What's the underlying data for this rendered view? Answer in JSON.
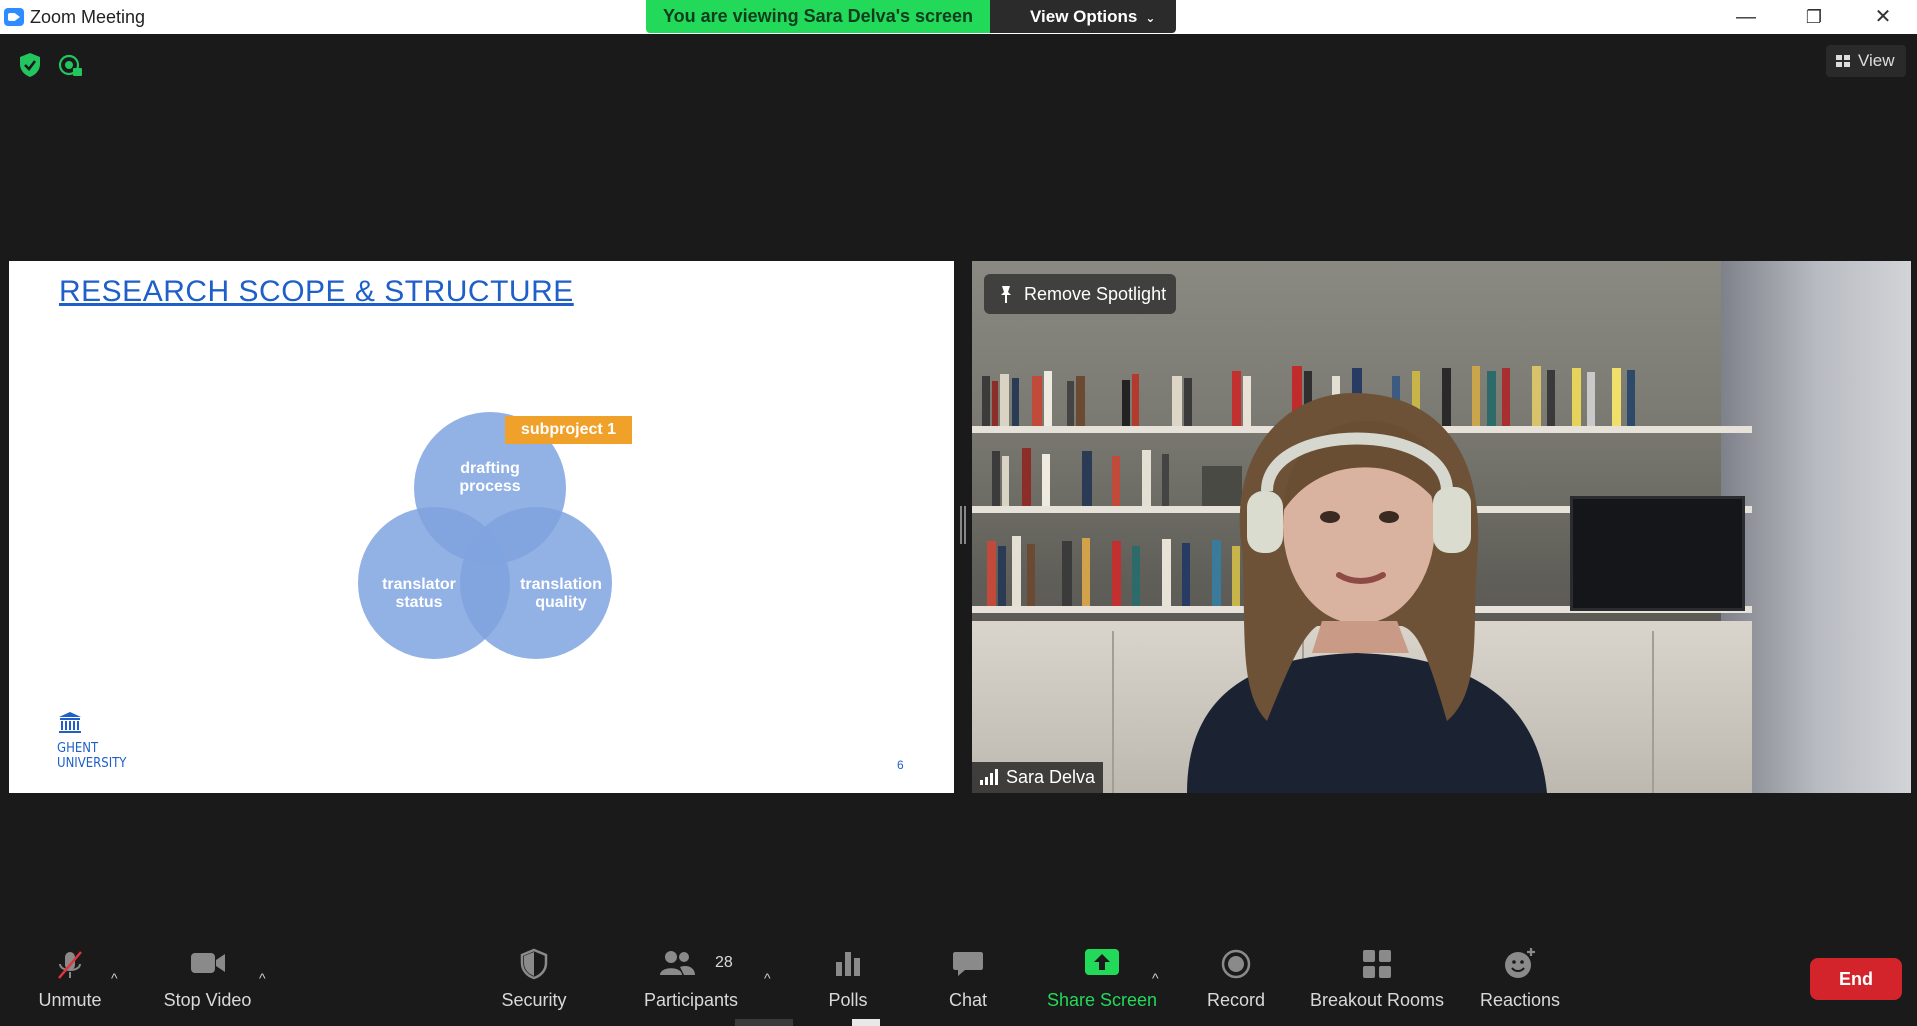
{
  "window": {
    "title": "Zoom Meeting",
    "minimize_glyph": "—",
    "restore_glyph": "❐",
    "close_glyph": "✕"
  },
  "banner": {
    "viewing_text": "You are viewing Sara Delva's screen",
    "view_options_label": "View Options",
    "chevron_glyph": "⌄"
  },
  "top_right": {
    "view_label": "View"
  },
  "slide": {
    "title": "RESEARCH SCOPE & STRUCTURE",
    "tag": "subproject 1",
    "circles": [
      {
        "line1": "drafting",
        "line2": "process"
      },
      {
        "line1": "translator",
        "line2": "status"
      },
      {
        "line1": "translation",
        "line2": "quality"
      }
    ],
    "logo_line1": "GHENT",
    "logo_line2": "UNIVERSITY",
    "page_number": "6"
  },
  "video": {
    "spotlight_label": "Remove Spotlight",
    "participant_name": "Sara Delva"
  },
  "toolbar": {
    "unmute_label": "Unmute",
    "stop_video_label": "Stop Video",
    "security_label": "Security",
    "participants_label": "Participants",
    "participants_count": "28",
    "polls_label": "Polls",
    "chat_label": "Chat",
    "share_screen_label": "Share Screen",
    "record_label": "Record",
    "breakout_label": "Breakout Rooms",
    "reactions_label": "Reactions",
    "end_label": "End",
    "caret_glyph": "^"
  },
  "colors": {
    "share_green": "#23d959",
    "end_red": "#d2242a",
    "slide_blue": "#1f5fc9",
    "venn_fill": "#7fa3df",
    "tag_orange": "#f0a12a"
  },
  "icons": {
    "security_status": "shield-check-icon",
    "recording_status": "recording-icon",
    "pin": "pin-icon",
    "signal": "signal-bars-icon"
  }
}
